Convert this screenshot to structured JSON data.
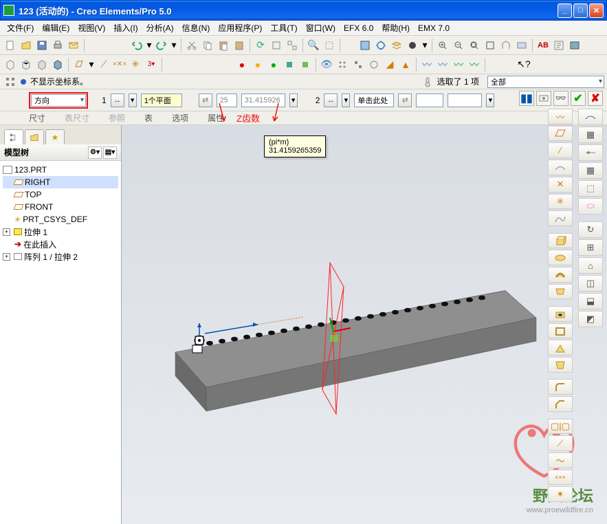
{
  "titlebar": {
    "title": "123 (活动的) - Creo Elements/Pro 5.0"
  },
  "menu": {
    "file": "文件(F)",
    "edit": "编辑(E)",
    "view": "视图(V)",
    "insert": "插入(I)",
    "analyze": "分析(A)",
    "info": "信息(N)",
    "app": "应用程序(P)",
    "tools": "工具(T)",
    "window": "窗口(W)",
    "efx": "EFX 6.0",
    "help": "帮助(H)",
    "emx": "EMX 7.0"
  },
  "infobar": {
    "status": "不显示坐标系。",
    "selected": "选取了 1 项",
    "filter": "全部"
  },
  "pattern": {
    "type": "方向",
    "count1": "1",
    "plane": "1个平面",
    "val1": "25",
    "val2": "31.415926",
    "count2": "2",
    "click_here": "单击此处",
    "annotation": "Z齿数"
  },
  "tabs": {
    "t1": "尺寸",
    "t2": "表尺寸",
    "t3": "参照",
    "t4": "表",
    "t5": "选项",
    "t6": "属性"
  },
  "tooltip": {
    "line1": "(pi*m)",
    "line2": "31.4159265359"
  },
  "tree": {
    "header": "模型树",
    "root": "123.PRT",
    "right": "RIGHT",
    "top": "TOP",
    "front": "FRONT",
    "csys": "PRT_CSYS_DEF",
    "extrude": "拉伸 1",
    "insert_here": "在此插入",
    "pattern": "阵列 1 / 拉伸 2"
  },
  "watermark": {
    "title": "野火论坛",
    "url": "www.proewildfire.cn"
  }
}
